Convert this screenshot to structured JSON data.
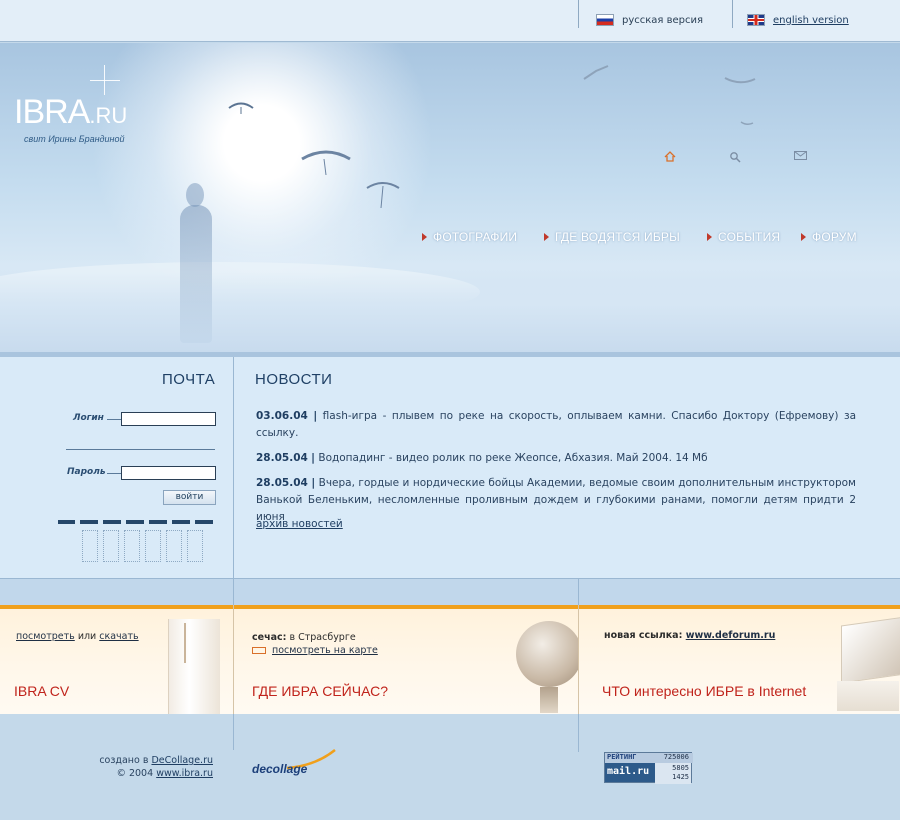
{
  "lang": {
    "ru": "русская версия",
    "en": "english version"
  },
  "logo": {
    "main": "IBRA",
    "suffix": ".RU",
    "tagline": "свит Ирины Брандиной"
  },
  "hero_icons": [
    "home-icon",
    "search-icon",
    "mail-icon"
  ],
  "menu": [
    {
      "label": "ФОТОГРАФИИ"
    },
    {
      "label": "ГДЕ ВОДЯТСЯ ИБРЫ"
    },
    {
      "label": "СОБЫТИЯ"
    },
    {
      "label": "ФОРУМ"
    }
  ],
  "mail": {
    "title": "ПОЧТА",
    "login_label": "Логин",
    "password_label": "Пароль",
    "submit": "войти"
  },
  "news": {
    "title": "НОВОСТИ",
    "items": [
      {
        "date": "03.06.04",
        "text": "flash-игра - плывем по реке на скорость, оплываем камни. Спасибо Доктору (Ефремову) за ссылку."
      },
      {
        "date": "28.05.04",
        "text": "Водопадинг - видео ролик по реке Жеопсе, Абхазия. Май 2004. 14 Мб"
      },
      {
        "date": "28.05.04",
        "text": "Вчера, гордые и нордические бойцы Академии, ведомые своим дополнительным инструктором Ванькой Беленьким, несломленные проливным дождем и глубокими ранами, помогли детям придти 2 июня"
      }
    ],
    "archive": "архив новостей",
    "separator": "|"
  },
  "promo": {
    "cv": {
      "view": "посмотреть",
      "or": "или",
      "download": "скачать",
      "title": "IBRA CV"
    },
    "where": {
      "now_label": "сечас:",
      "now_value": "в Страсбурге",
      "map_link": "посмотреть на карте",
      "title": "ГДЕ ИБРА СЕЙЧАС?"
    },
    "internet": {
      "link_label": "новая ссылка:",
      "link_value": "www.deforum.ru",
      "title": "ЧТО интересно ИБРЕ в Internet"
    }
  },
  "footer": {
    "created_prefix": "создано в",
    "created_link": "DeCollage.ru",
    "copyright_prefix": "© 2004",
    "copyright_link": "www.ibra.ru",
    "decollage": "decollage",
    "rating": {
      "label": "РЕЙТИНГ",
      "total": "725006",
      "logo": "mail.ru",
      "n1": "5805",
      "n2": "1425"
    }
  },
  "colors": {
    "accent_orange": "#f0a01c",
    "promo_title_red": "#c0231b",
    "menu_arrow": "#c0392b",
    "content_bg": "#d9eaf8"
  }
}
